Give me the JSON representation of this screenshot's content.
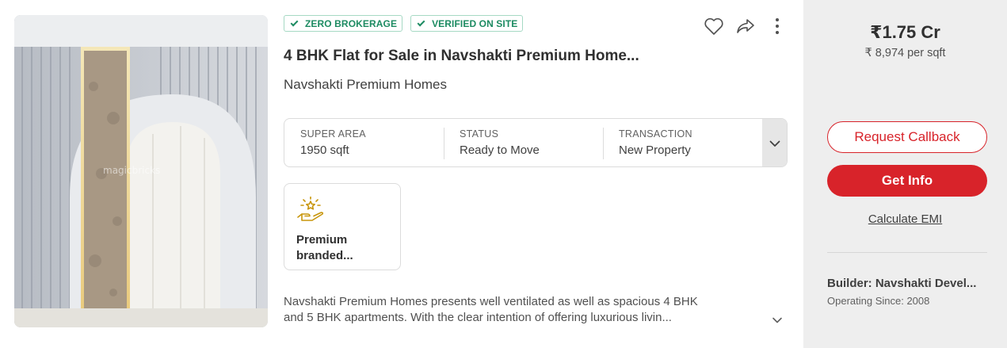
{
  "listing": {
    "photo_watermark": "magicbricks",
    "badges": [
      "ZERO BROKERAGE",
      "VERIFIED ON SITE"
    ],
    "actions": {
      "shortlist_icon": "heart-icon",
      "share_icon": "share-arrow-icon",
      "more_icon": "kebab-menu-icon"
    },
    "title": "4 BHK Flat for Sale in Navshakti Premium Home...",
    "project_name": "Navshakti Premium Homes",
    "specs": [
      {
        "label": "SUPER AREA",
        "value": "1950 sqft"
      },
      {
        "label": "STATUS",
        "value": "Ready to Move"
      },
      {
        "label": "TRANSACTION",
        "value": "New Property"
      }
    ],
    "feature": {
      "icon": "premium-hand-star-icon",
      "text": "Premium branded..."
    },
    "description": {
      "line1": "Navshakti Premium Homes presents well ventilated as well as spacious 4 BHK",
      "line2": "and 5 BHK apartments. With the clear intention of offering luxurious livin..."
    }
  },
  "panel": {
    "price": "₹1.75 Cr",
    "price_per_sqft": "₹ 8,974 per sqft",
    "request_callback": "Request Callback",
    "get_info": "Get Info",
    "calculate_emi": "Calculate EMI",
    "builder": "Builder: Navshakti Devel...",
    "operating_since": "Operating Since: 2008"
  },
  "colors": {
    "brand_red": "#d8232a",
    "verified_green": "#1d8b62",
    "panel_bg": "#eeeeee",
    "feature_gold": "#c8960c"
  }
}
